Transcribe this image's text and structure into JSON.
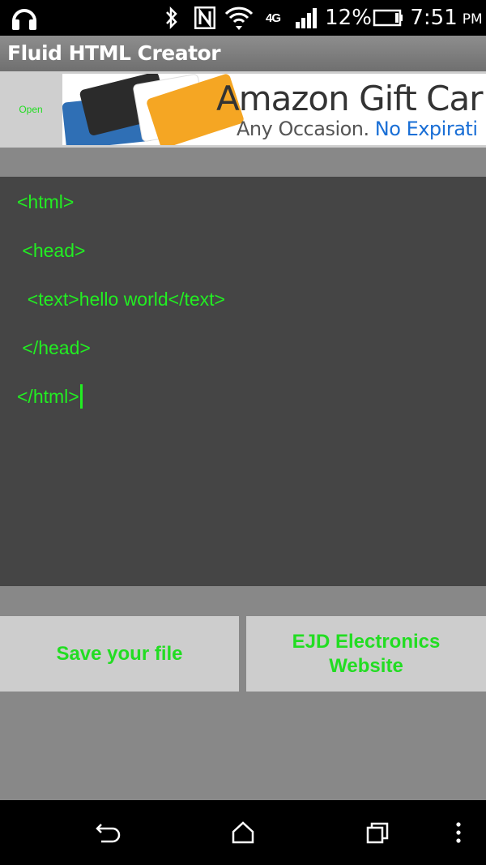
{
  "status_bar": {
    "network": "4G",
    "battery_percent": "12%",
    "battery_level": 0.12,
    "time": "7:51",
    "ampm": "PM",
    "icons": [
      "headphones-icon",
      "bluetooth-icon",
      "nfc-icon",
      "wifi-icon",
      "signal-icon",
      "battery-icon"
    ]
  },
  "app": {
    "title": "Fluid HTML Creator"
  },
  "ad": {
    "open_label": "Open",
    "headline": "Amazon Gift Car",
    "sub_prefix": "Any Occasion.",
    "sub_accent": "No Expirati",
    "accent_color": "#1a6fd6"
  },
  "editor": {
    "text_color": "#22ee22",
    "background": "#454545",
    "lines": [
      "<html>",
      " <head>",
      "  <text>hello world</text>",
      " </head>",
      "</html>"
    ]
  },
  "buttons": {
    "save_label": "Save your file",
    "ejd_label_line1": "EJD Electronics",
    "ejd_label_line2": "Website"
  },
  "nav": {
    "icons": [
      "back-icon",
      "home-icon",
      "recent-apps-icon",
      "menu-icon"
    ]
  }
}
